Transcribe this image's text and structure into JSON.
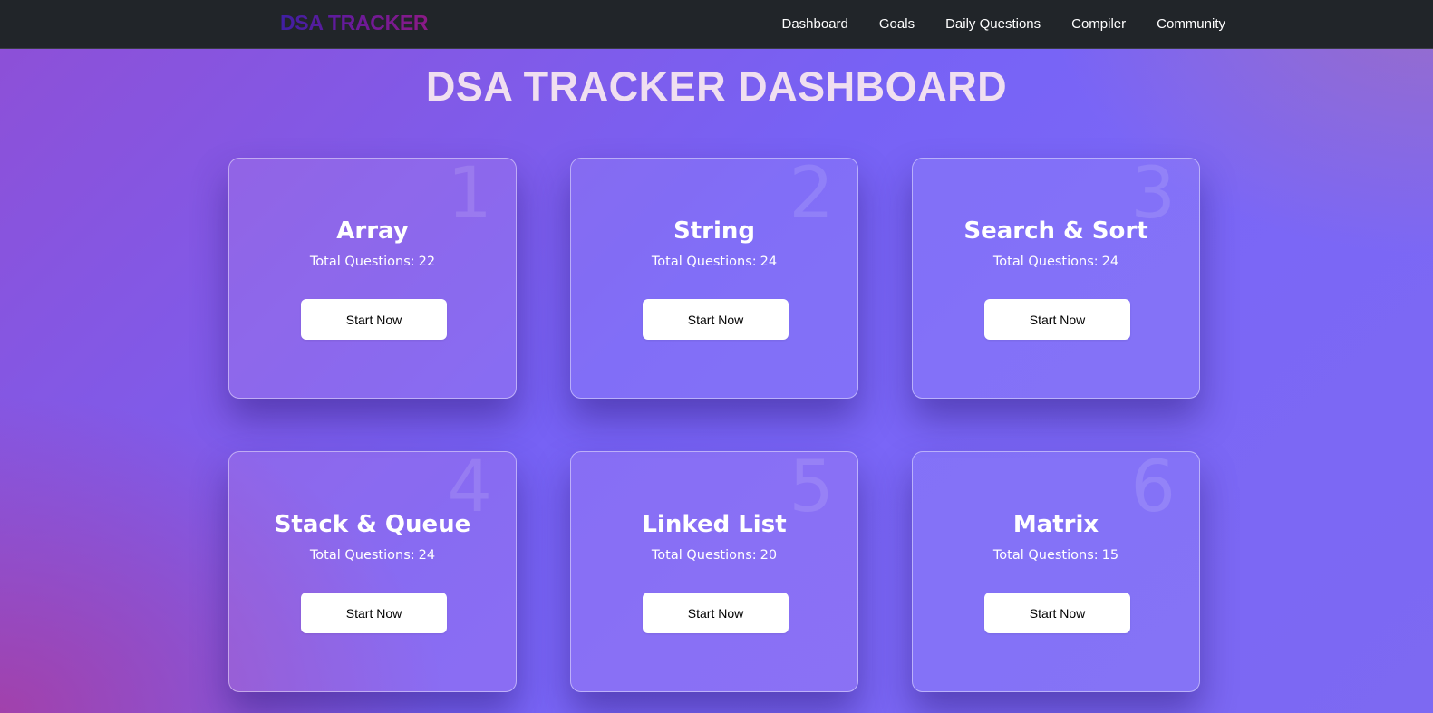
{
  "navbar": {
    "brand": "DSA TRACKER",
    "links": [
      "Dashboard",
      "Goals",
      "Daily Questions",
      "Compiler",
      "Community"
    ]
  },
  "page": {
    "title": "DSA TRACKER DASHBOARD"
  },
  "cards": [
    {
      "number": "1",
      "title": "Array",
      "total_label": "Total Questions:",
      "total": "22",
      "button_label": "Start Now"
    },
    {
      "number": "2",
      "title": "String",
      "total_label": "Total Questions:",
      "total": "24",
      "button_label": "Start Now"
    },
    {
      "number": "3",
      "title": "Search & Sort",
      "total_label": "Total Questions:",
      "total": "24",
      "button_label": "Start Now"
    },
    {
      "number": "4",
      "title": "Stack & Queue",
      "total_label": "Total Questions:",
      "total": "24",
      "button_label": "Start Now"
    },
    {
      "number": "5",
      "title": "Linked List",
      "total_label": "Total Questions:",
      "total": "20",
      "button_label": "Start Now"
    },
    {
      "number": "6",
      "title": "Matrix",
      "total_label": "Total Questions:",
      "total": "15",
      "button_label": "Start Now"
    }
  ],
  "colors": {
    "navbar_bg": "#212529",
    "title_text": "#f0dff0",
    "button_bg": "#ffffff",
    "background_accent": "#7762f5"
  }
}
